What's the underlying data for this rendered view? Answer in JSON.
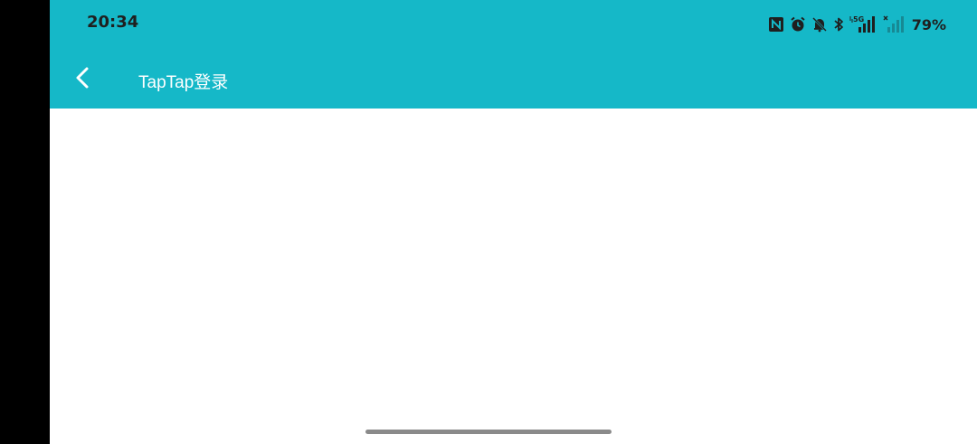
{
  "status_bar": {
    "time": "20:34",
    "battery_percent": "79%",
    "network_label": "5G",
    "icons": [
      "nfc-icon",
      "alarm-icon",
      "mute-icon",
      "bluetooth-icon",
      "signal-5g-icon",
      "signal-nosim-icon"
    ]
  },
  "app_bar": {
    "title": "TapTap登录",
    "back_icon": "chevron-left-icon"
  },
  "colors": {
    "app_bar": "#15b8c8",
    "status_text": "#1f1f1f",
    "title_text": "#ffffff",
    "background": "#ffffff",
    "home_indicator": "#8a8a8a"
  }
}
